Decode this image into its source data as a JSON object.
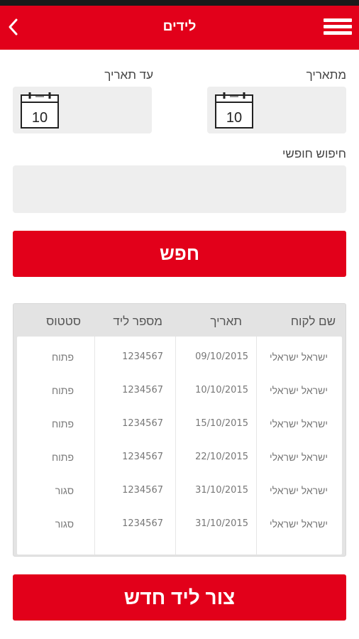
{
  "header": {
    "title": "לידים",
    "back_icon": "chevron-left-icon",
    "menu_icon": "hamburger-menu-icon",
    "background": "#e2001a"
  },
  "filters": {
    "from_date_label": "מתאריך",
    "to_date_label": "עד תאריך",
    "calendar_day": "10",
    "free_search_label": "חיפוש חופשי",
    "free_search_value": ""
  },
  "search_button_label": "חפש",
  "table": {
    "headers": {
      "customer_name": "שם לקוח",
      "date": "תאריך",
      "lead_number": "מספר ליד",
      "status": "סטטוס"
    },
    "rows": [
      {
        "customer_name": "ישראל ישראלי",
        "date": "09/10/2015",
        "lead_number": "1234567",
        "status": "פתוח"
      },
      {
        "customer_name": "ישראל ישראלי",
        "date": "10/10/2015",
        "lead_number": "1234567",
        "status": "פתוח"
      },
      {
        "customer_name": "ישראל ישראלי",
        "date": "15/10/2015",
        "lead_number": "1234567",
        "status": "פתוח"
      },
      {
        "customer_name": "ישראל ישראלי",
        "date": "22/10/2015",
        "lead_number": "1234567",
        "status": "פתוח"
      },
      {
        "customer_name": "ישראל ישראלי",
        "date": "31/10/2015",
        "lead_number": "1234567",
        "status": "סגור"
      },
      {
        "customer_name": "ישראל ישראלי",
        "date": "31/10/2015",
        "lead_number": "1234567",
        "status": "סגור"
      }
    ]
  },
  "create_lead_button_label": "צור ליד חדש"
}
